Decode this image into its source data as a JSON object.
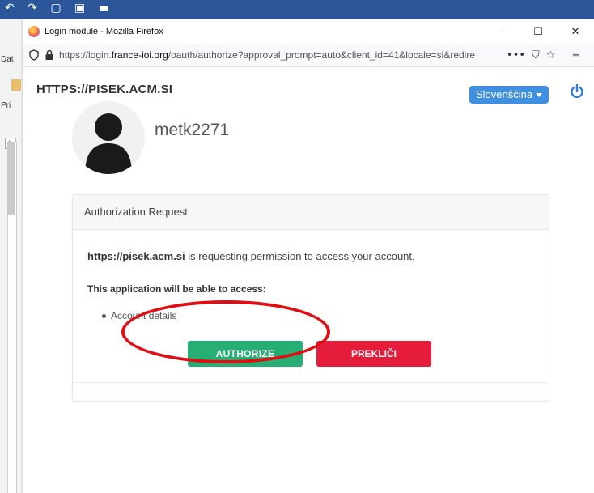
{
  "background_app": {
    "qat_glyphs": "↶ ↷ ▢ ▣ ▬",
    "tab_1": "Dat",
    "tab_2": "Pri",
    "ruler_button": "L"
  },
  "window": {
    "title": "Login module - Mozilla Firefox",
    "minimize": "–",
    "maximize": "☐",
    "close": "✕"
  },
  "navbar": {
    "url_prefix": "https://login.",
    "url_domain": "france-ioi.org",
    "url_rest": "/oauth/authorize?approval_prompt=auto&client_id=41&locale=sl&redire",
    "more_actions": "•••",
    "pocket": "⛉",
    "bookmark": "☆",
    "menu": "≡"
  },
  "header": {
    "site_name": "HTTPS://PISEK.ACM.SI",
    "language": "Slovenščina"
  },
  "user": {
    "username": "metk2271"
  },
  "card": {
    "title": "Authorization Request",
    "requester": "https://pisek.acm.si",
    "request_text": " is requesting permission to access your account.",
    "access_title": "This application will be able to access:",
    "access_items": [
      "Account details"
    ],
    "authorize_label": "AUTHORIZE",
    "cancel_label": "PREKLIČI"
  },
  "colors": {
    "authorize": "#27ae75",
    "cancel": "#e51c3b",
    "language_button": "#3f8fe0",
    "power_icon": "#2f7fd8",
    "annotation": "#e00d12"
  }
}
